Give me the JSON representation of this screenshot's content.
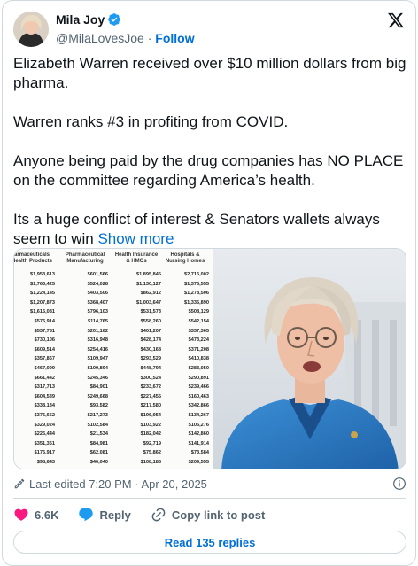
{
  "author": {
    "display_name": "Mila Joy",
    "handle": "@MilaLovesJoe",
    "separator": "·",
    "follow_label": "Follow"
  },
  "tweet": {
    "paragraphs": [
      "Elizabeth Warren received over $10 million dollars from big pharma.",
      "Warren ranks #3 in profiting from COVID.",
      "Anyone being paid by the drug companies has NO PLACE on the committee regarding America’s health.",
      "Its a huge conflict of interest & Senators wallets always seem to win"
    ],
    "show_more_label": "Show more"
  },
  "media": {
    "columns": [
      {
        "header": "armaceuticals\nHealth Products",
        "values": [
          "$1,953,613",
          "$1,763,425",
          "$1,224,145",
          "$1,207,873",
          "$1,616,081",
          "$575,914",
          "$537,781",
          "$730,106",
          "$609,514",
          "$357,867",
          "$467,099",
          "$661,442",
          "$317,713",
          "$604,539",
          "$338,134",
          "$375,652",
          "$329,024",
          "$226,444",
          "$351,361",
          "$175,917",
          "$98,643"
        ]
      },
      {
        "header": "Pharmaceutical\nManufacturing",
        "values": [
          "$601,566",
          "$524,028",
          "$403,506",
          "$368,407",
          "$796,103",
          "$114,765",
          "$201,162",
          "$316,948",
          "$254,416",
          "$109,947",
          "$109,894",
          "$245,346",
          "$84,901",
          "$249,668",
          "$93,582",
          "$217,273",
          "$102,584",
          "$21,534",
          "$84,981",
          "$62,081",
          "$40,040"
        ]
      },
      {
        "header": "Health Insurance\n& HMOs",
        "values": [
          "$1,895,845",
          "$1,130,127",
          "$862,912",
          "$1,003,647",
          "$531,573",
          "$558,260",
          "$401,207",
          "$428,174",
          "$430,168",
          "$293,529",
          "$448,794",
          "$300,524",
          "$233,672",
          "$227,455",
          "$217,580",
          "$196,954",
          "$103,922",
          "$182,042",
          "$92,719",
          "$75,862",
          "$108,185"
        ]
      },
      {
        "header": "Hospitals &\nNursing Homes",
        "values": [
          "$2,715,002",
          "$1,375,555",
          "$1,278,506",
          "$1,335,890",
          "$508,129",
          "$542,154",
          "$337,365",
          "$473,224",
          "$371,208",
          "$410,838",
          "$283,050",
          "$290,891",
          "$239,466",
          "$160,463",
          "$342,866",
          "$134,267",
          "$105,276",
          "$142,860",
          "$141,914",
          "$73,584",
          "$209,555"
        ]
      }
    ]
  },
  "meta": {
    "last_edited": "Last edited 7:20 PM · Apr 20, 2025"
  },
  "actions": {
    "like_count": "6.6K",
    "reply_label": "Reply",
    "copy_link_label": "Copy link to post",
    "read_replies_label": "Read 135 replies"
  },
  "colors": {
    "link_blue": "#006fd6",
    "like_red": "#f91880",
    "muted": "#536471",
    "border": "#cfd9de"
  },
  "icons": [
    "verified-badge-icon",
    "x-logo-icon",
    "edit-pencil-icon",
    "info-icon",
    "heart-icon",
    "reply-bubble-icon",
    "link-icon"
  ]
}
